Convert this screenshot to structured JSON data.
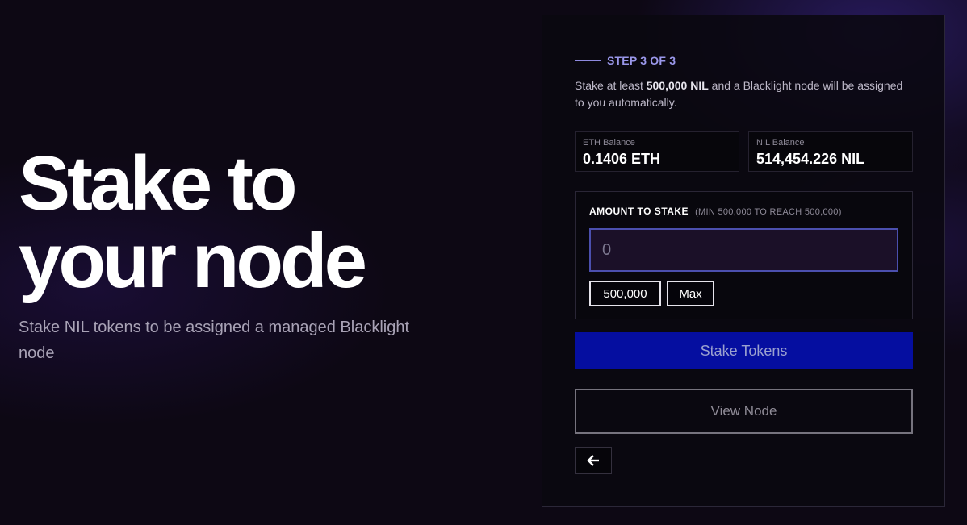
{
  "hero": {
    "title_line1": "Stake to",
    "title_line2": "your node",
    "subtitle": "Stake NIL tokens to be assigned a managed Blacklight node"
  },
  "panel": {
    "step": "STEP 3 OF 3",
    "description_prefix": "Stake at least ",
    "description_amount": "500,000 NIL",
    "description_suffix": " and a Blacklight node will be assigned to you automatically.",
    "balances": {
      "eth_label": "ETH Balance",
      "eth_value": "0.1406 ETH",
      "nil_label": "NIL Balance",
      "nil_value": "514,454.226 NIL"
    },
    "amount": {
      "title": "AMOUNT TO STAKE",
      "hint": "(MIN 500,000 TO REACH 500,000)",
      "placeholder": "0",
      "value": "",
      "quick_amount": "500,000",
      "max_label": "Max"
    },
    "stake_button": "Stake Tokens",
    "view_node_button": "View Node",
    "back_icon": "arrow-left-icon"
  },
  "colors": {
    "accent": "#9a97ea",
    "stake_button_bg": "#050ea0",
    "input_border": "#4b4fae",
    "background": "#0d0814"
  }
}
